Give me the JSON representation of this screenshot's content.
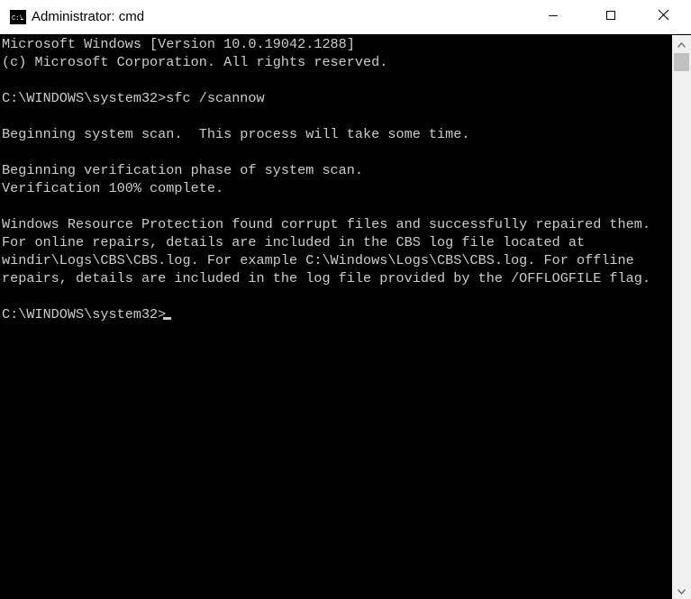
{
  "window": {
    "title": "Administrator: cmd",
    "icon": "cmd-console-icon",
    "controls": {
      "minimize": "minimize-icon",
      "maximize": "maximize-icon",
      "close": "close-icon"
    }
  },
  "console": {
    "lines": [
      "Microsoft Windows [Version 10.0.19042.1288]",
      "(c) Microsoft Corporation. All rights reserved.",
      "",
      "C:\\WINDOWS\\system32>sfc /scannow",
      "",
      "Beginning system scan.  This process will take some time.",
      "",
      "Beginning verification phase of system scan.",
      "Verification 100% complete.",
      "",
      "Windows Resource Protection found corrupt files and successfully repaired them.",
      "For online repairs, details are included in the CBS log file located at",
      "windir\\Logs\\CBS\\CBS.log. For example C:\\Windows\\Logs\\CBS\\CBS.log. For offline",
      "repairs, details are included in the log file provided by the /OFFLOGFILE flag.",
      "",
      "C:\\WINDOWS\\system32>"
    ]
  },
  "colors": {
    "console_bg": "#000000",
    "console_text": "#cccccc",
    "titlebar_bg": "#ffffff",
    "scrollbar_bg": "#f0f0f0",
    "scrollbar_thumb": "#c1c1c1"
  }
}
